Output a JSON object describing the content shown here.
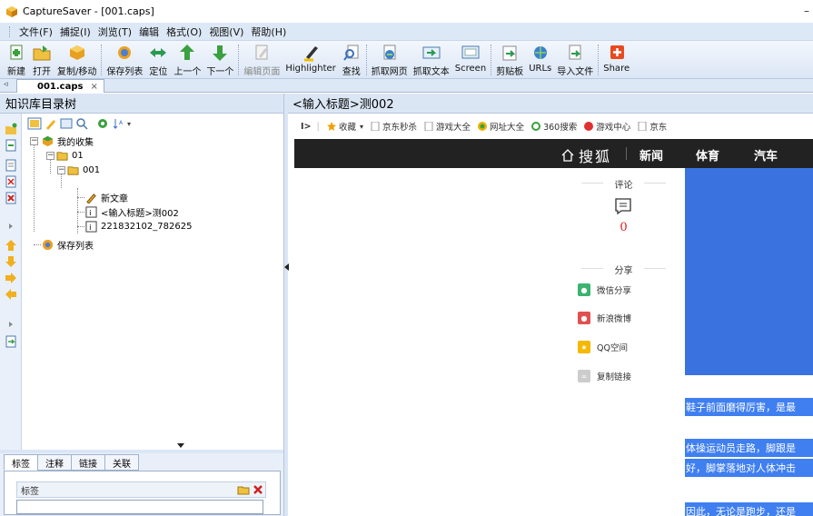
{
  "window": {
    "title": "CaptureSaver - [001.caps]",
    "minimize_glyph": "–"
  },
  "menubar": [
    "文件(F)",
    "捕捉(I)",
    "浏览(T)",
    "编辑",
    "格式(O)",
    "视图(V)",
    "帮助(H)"
  ],
  "toolbar": {
    "new": "新建",
    "open": "打开",
    "copy_move": "复制/移动",
    "save_list": "保存列表",
    "locate": "定位",
    "prev": "上一个",
    "next": "下一个",
    "edit_page": "编辑页面",
    "highlighter": "Highlighter",
    "find": "查找",
    "capture_web": "抓取网页",
    "capture_text": "抓取文本",
    "screen": "Screen",
    "clipboard": "剪贴板",
    "urls": "URLs",
    "import_file": "导入文件",
    "share": "Share"
  },
  "doc_tab": {
    "label": "001.caps",
    "close": "×"
  },
  "left_panel": {
    "title": "知识库目录树",
    "tree": {
      "root": "我的收集",
      "folder1": "01",
      "folder2": "001",
      "item_new": "新文章",
      "item_selected": "<输入标题>测002",
      "item_num": "221832102_782625",
      "saved_list": "保存列表"
    }
  },
  "bottom_panel": {
    "tabs": [
      "标签",
      "注释",
      "链接",
      "关联"
    ],
    "tag_label": "标签"
  },
  "right_panel": {
    "title": "<输入标题>测002"
  },
  "bookmarks": {
    "collect": "收藏",
    "jd_flash": "京东秒杀",
    "games": "游戏大全",
    "site_nav": "网址大全",
    "s360": "360搜索",
    "game_center": "游戏中心",
    "jd": "京东"
  },
  "sohu": {
    "logo": "搜狐",
    "nav": [
      "新闻",
      "体育",
      "汽车"
    ]
  },
  "article": {
    "comment_title": "评论",
    "comment_count": "0",
    "share_title": "分享",
    "wechat": "微信分享",
    "weibo": "新浪微博",
    "qzone": "QQ空间",
    "copy_link": "复制链接",
    "lines": [
      "鞋子前面磨得厉害，是最",
      "体操运动员走路，脚跟是",
      "好，脚掌落地对人体冲击",
      "因此，无论是跑步，还是"
    ]
  }
}
